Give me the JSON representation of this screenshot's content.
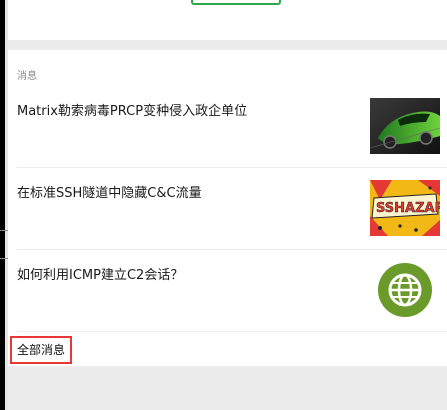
{
  "section": {
    "label": "消息",
    "items": [
      {
        "title": "Matrix勒索病毒PRCP变种侵入政企单位",
        "thumb_icon": "green-sports-car-image"
      },
      {
        "title": "在标准SSH隧道中隐藏C&C流量",
        "thumb_icon": "ssh-hazard-comic-image",
        "thumb_text": "SSHAZAR"
      },
      {
        "title": "如何利用ICMP建立C2会话？",
        "thumb_icon": "globe-icon"
      }
    ],
    "all_link": "全部消息"
  },
  "colors": {
    "accent_green": "#2aa84a",
    "highlight_red": "#e53935",
    "band_gray": "#ececec"
  }
}
